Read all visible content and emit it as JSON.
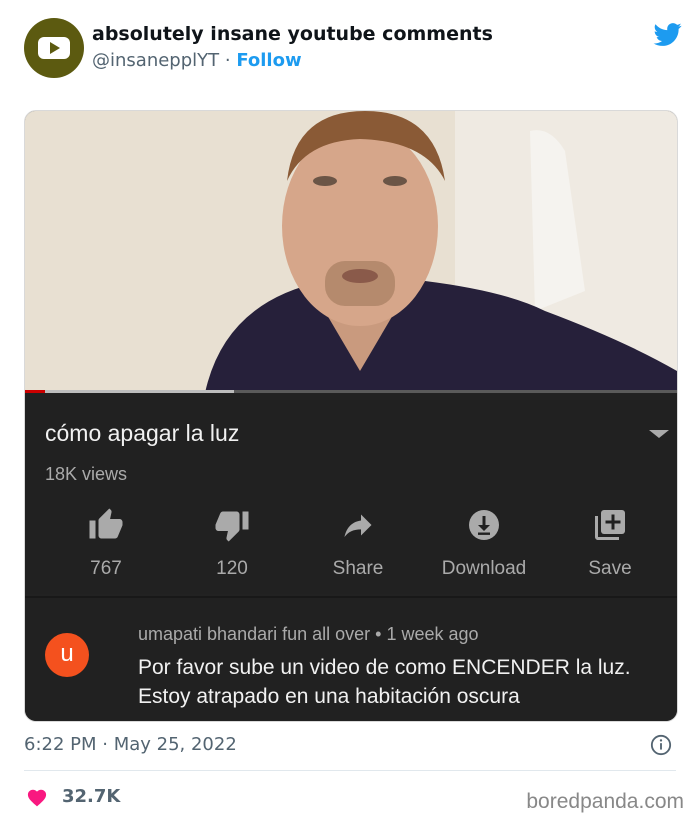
{
  "tweet": {
    "author_name": "absolutely insane youtube comments",
    "handle": "@insanepplYT",
    "separator": " · ",
    "follow_label": "Follow",
    "timestamp": "6:22 PM · May 25, 2022",
    "likes": "32.7K"
  },
  "video": {
    "title": "cómo apagar la luz",
    "views": "18K views",
    "progress_fraction": 0.03,
    "buffer_fraction": 0.32,
    "actions": [
      {
        "icon": "thumbs-up-icon",
        "label": "767"
      },
      {
        "icon": "thumbs-down-icon",
        "label": "120"
      },
      {
        "icon": "share-icon",
        "label": "Share"
      },
      {
        "icon": "download-icon",
        "label": "Download"
      },
      {
        "icon": "save-icon",
        "label": "Save"
      }
    ]
  },
  "comment": {
    "avatar_letter": "u",
    "meta": "umapati bhandari fun all over • 1 week ago",
    "text": "Por favor sube un video de como ENCENDER la luz. Estoy atrapado en una habitación oscura"
  },
  "watermark": "boredpanda.com",
  "colors": {
    "twitter_blue": "#1d9bf0",
    "youtube_dark": "#212121",
    "comment_avatar": "#f4511e",
    "heart": "#f91880"
  }
}
